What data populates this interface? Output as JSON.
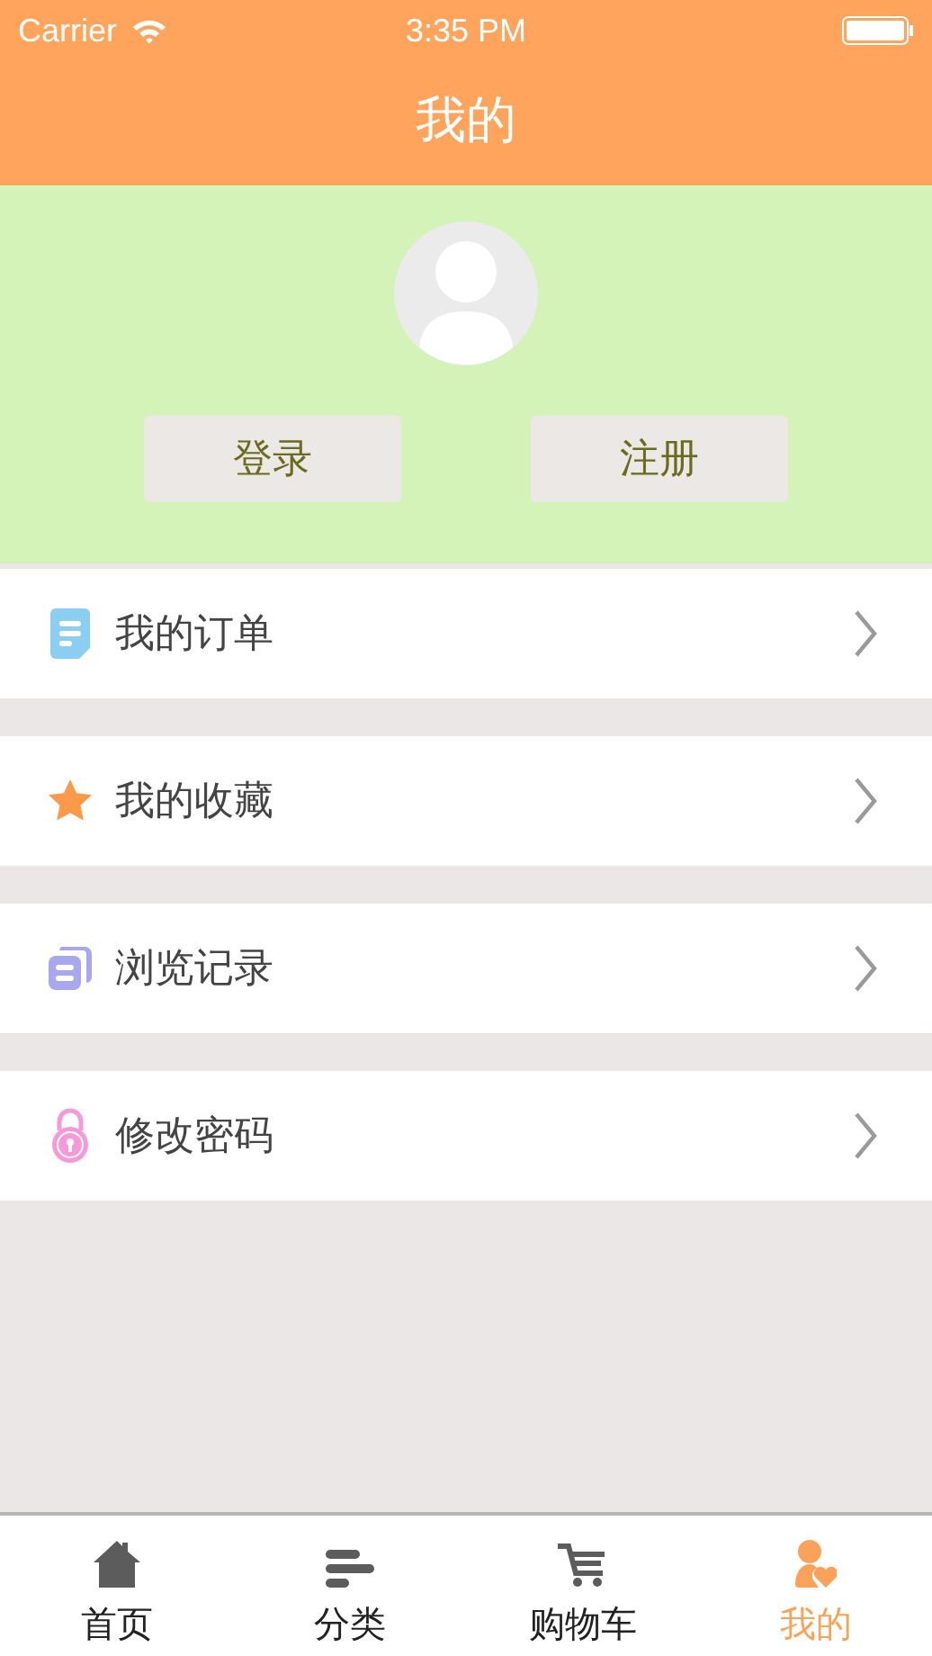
{
  "status_bar": {
    "carrier": "Carrier",
    "time": "3:35 PM"
  },
  "nav": {
    "title": "我的"
  },
  "header": {
    "buttons": [
      "登录",
      "注册"
    ]
  },
  "menu": [
    {
      "kind": "order",
      "label": "我的订单"
    },
    {
      "kind": "favorite",
      "label": "我的收藏"
    },
    {
      "kind": "history",
      "label": "浏览记录"
    },
    {
      "kind": "password",
      "label": "修改密码"
    }
  ],
  "tab_bar": [
    {
      "kind": "home",
      "label": "首页",
      "selected": false
    },
    {
      "kind": "category",
      "label": "分类",
      "selected": false
    },
    {
      "kind": "cart",
      "label": "购物车",
      "selected": false
    },
    {
      "kind": "mine",
      "label": "我的",
      "selected": true
    }
  ]
}
